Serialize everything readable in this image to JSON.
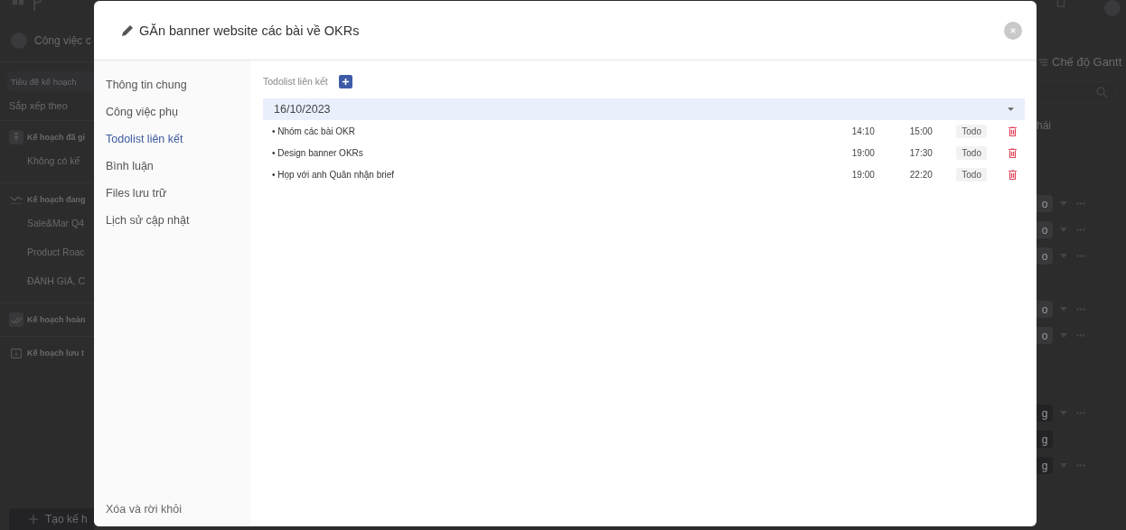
{
  "background": {
    "app_title": "Công việc c",
    "search": {
      "placeholder": "Tiêu đề kế hoạch"
    },
    "sort_label": "Sắp xếp theo",
    "groups": [
      {
        "kind": "pinned",
        "title": "Kế hoạch đã gi",
        "items": [
          "Không có kế"
        ]
      },
      {
        "kind": "active",
        "title": "Kế hoạch đang",
        "items": [
          "Sale&Mar Q4",
          "Product Roac",
          "ĐÁNH GIÁ, C"
        ]
      },
      {
        "kind": "done",
        "title": "Kế hoạch hoàn"
      },
      {
        "kind": "archived",
        "title": "Kế hoạch lưu t"
      }
    ],
    "create_button": "Tạo kế h",
    "view_mode": "Chế độ Gantt",
    "column_text": "hái",
    "status_groups": [
      {
        "rows": [
          {
            "label": "o",
            "menu": true
          },
          {
            "label": "o",
            "menu": true
          },
          {
            "label": "o",
            "menu": true
          }
        ]
      },
      {
        "rows": [
          {
            "label": "o",
            "menu": true
          },
          {
            "label": "o",
            "menu": true
          }
        ]
      },
      {
        "rows": [
          {
            "label": "g",
            "menu": true
          },
          {
            "label": "g",
            "menu": false
          },
          {
            "label": "g",
            "menu": true
          }
        ]
      }
    ]
  },
  "dialog": {
    "title": "GĂn banner website các bài về OKRs",
    "tabs": [
      {
        "label": "Thông tin chung",
        "selected": false
      },
      {
        "label": "Công việc phụ",
        "selected": false
      },
      {
        "label": "Todolist liên kết",
        "selected": true
      },
      {
        "label": "Bình luận",
        "selected": false
      },
      {
        "label": "Files lưu trữ",
        "selected": false
      },
      {
        "label": "Lịch sử cập nhật",
        "selected": false
      }
    ],
    "danger_action": "Xóa và rời khỏi",
    "section_label": "Todolist liên kết",
    "date_groups": [
      {
        "date": "16/10/2023",
        "expanded": true,
        "tasks": [
          {
            "name": "• Nhóm các bài OKR",
            "start": "14:10",
            "end": "15:00",
            "status": "Todo"
          },
          {
            "name": "• Design banner OKRs",
            "start": "19:00",
            "end": "17:30",
            "status": "Todo"
          },
          {
            "name": "• Họp với anh Quân nhận brief",
            "start": "19:00",
            "end": "22:20",
            "status": "Todo"
          }
        ]
      }
    ]
  }
}
